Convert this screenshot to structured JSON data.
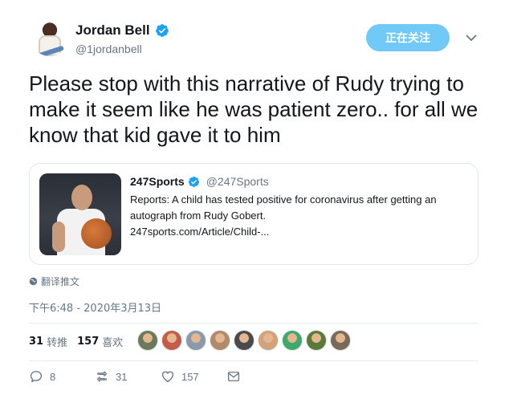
{
  "author": {
    "display_name": "Jordan Bell",
    "handle": "@1jordanbell",
    "follow_label": "正在关注"
  },
  "tweet": {
    "text": "Please stop with this narrative of Rudy trying to make it seem like he was patient zero.. for all we know that kid gave it to him"
  },
  "card": {
    "source_name": "247Sports",
    "source_handle": "@247Sports",
    "description": "Reports: A child has tested positive for coronavirus after getting an autograph from Rudy Gobert.",
    "url": "247sports.com/Article/Child-..."
  },
  "translate_label": "翻译推文",
  "timestamp": "下午6:48 - 2020年3月13日",
  "stats": {
    "retweets_count": "31",
    "retweets_label": "转推",
    "likes_count": "157",
    "likes_label": "喜欢"
  },
  "likers": [
    "#6b7a5a",
    "#c45c4a",
    "#8a9aaa",
    "#b08a6a",
    "#4a4a4a",
    "#d2a27a",
    "#3fa86a",
    "#5a7a3a",
    "#7a6a5a"
  ],
  "actions": {
    "replies": "8",
    "retweets": "31",
    "likes": "157"
  },
  "colors": {
    "accent": "#1da1f2",
    "follow_button": "#71c9f8",
    "muted": "#657786"
  }
}
